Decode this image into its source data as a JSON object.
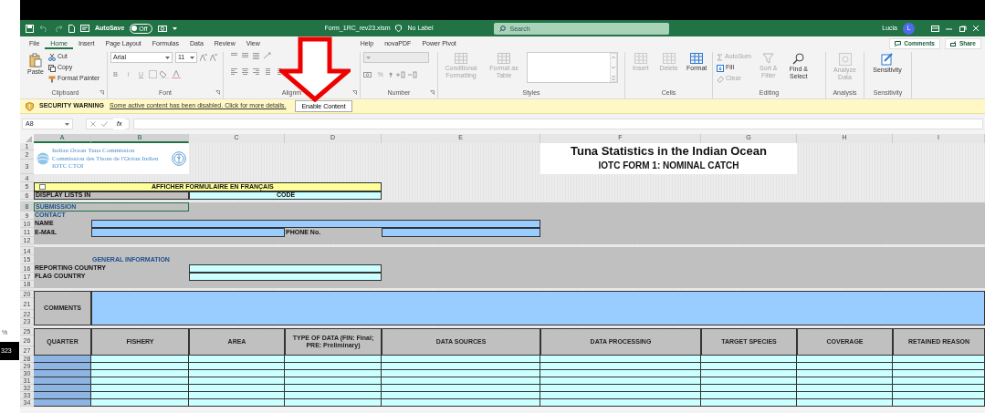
{
  "left_edge": {
    "zoom_fragment": "%",
    "page_fragment": "323"
  },
  "title_bar": {
    "autosave_label": "AutoSave",
    "autosave_toggle": {
      "label": "Off",
      "on": false
    },
    "filename": "Form_1RC_rev23.xlsm",
    "sensitivity_label": "No Label",
    "search": {
      "placeholder": "Search"
    },
    "user": "Lucia",
    "avatar": "L"
  },
  "ribbon_tabs": [
    {
      "label": "File",
      "selected": false
    },
    {
      "label": "Home",
      "selected": true
    },
    {
      "label": "Insert",
      "selected": false
    },
    {
      "label": "Page Layout",
      "selected": false
    },
    {
      "label": "Formulas",
      "selected": false
    },
    {
      "label": "Data",
      "selected": false
    },
    {
      "label": "Review",
      "selected": false
    },
    {
      "label": "View",
      "selected": false
    },
    {
      "label": "Help",
      "selected": false
    },
    {
      "label": "novaPDF",
      "selected": false
    },
    {
      "label": "Power Pivot",
      "selected": false
    }
  ],
  "ribbon_actions": [
    "Comments",
    "Share"
  ],
  "ribbon_groups": [
    {
      "label": "Clipboard",
      "kind": "clipboard",
      "items": [
        {
          "label": "Paste",
          "disabled": false
        },
        {
          "label": "Cut",
          "disabled": false
        },
        {
          "label": "Copy",
          "disabled": false
        },
        {
          "label": "Format Painter",
          "disabled": false
        }
      ]
    },
    {
      "label": "Font",
      "kind": "font",
      "font_name": "Arial",
      "font_size": "11",
      "items": [
        {
          "label": "B",
          "disabled": true
        },
        {
          "label": "I",
          "disabled": true
        },
        {
          "label": "U",
          "disabled": true
        }
      ]
    },
    {
      "label": "Alignm",
      "kind": "alignment"
    },
    {
      "label": "Number",
      "kind": "number",
      "items": [
        {
          "label": "%",
          "disabled": true
        }
      ]
    },
    {
      "label": "Styles",
      "kind": "styles",
      "items": [
        {
          "label": "Conditional Formatting",
          "disabled": true
        },
        {
          "label": "Format as Table",
          "disabled": true
        }
      ]
    },
    {
      "label": "Cells",
      "kind": "large",
      "items": [
        {
          "label": "Insert",
          "disabled": true
        },
        {
          "label": "Delete",
          "disabled": true
        },
        {
          "label": "Format",
          "disabled": false
        }
      ]
    },
    {
      "label": "Editing",
      "kind": "editing",
      "items": [
        {
          "label": "AutoSum",
          "disabled": true
        },
        {
          "label": "Fill",
          "disabled": false
        },
        {
          "label": "Clear",
          "disabled": true
        },
        {
          "label": "Sort & Filter",
          "disabled": true
        },
        {
          "label": "Find & Select",
          "disabled": false
        }
      ]
    },
    {
      "label": "Analysis",
      "kind": "large",
      "items": [
        {
          "label": "Analyze Data",
          "disabled": true
        }
      ]
    },
    {
      "label": "Sensitivity",
      "kind": "large",
      "items": [
        {
          "label": "Sensitivity",
          "disabled": false
        }
      ]
    }
  ],
  "security_bar": {
    "label": "SECURITY WARNING",
    "message": "Some active content has been disabled. Click for more details.",
    "button": "Enable Content"
  },
  "formula_bar": {
    "name_box": "A8",
    "function_symbol": "fx"
  },
  "sheet": {
    "columns": [
      {
        "label": "A",
        "selected": true
      },
      {
        "label": "B",
        "selected": true
      },
      {
        "label": "C",
        "selected": false
      },
      {
        "label": "D",
        "selected": false
      },
      {
        "label": "E",
        "selected": false
      },
      {
        "label": "F",
        "selected": false
      },
      {
        "label": "G",
        "selected": false
      },
      {
        "label": "H",
        "selected": false
      },
      {
        "label": "I",
        "selected": false
      }
    ],
    "rows": [
      {
        "label": "1",
        "selected": false
      },
      {
        "label": "2",
        "selected": false
      },
      {
        "label": "3",
        "selected": false
      },
      {
        "label": "4",
        "selected": false
      },
      {
        "label": "5",
        "selected": false
      },
      {
        "label": "6",
        "selected": false
      },
      {
        "selected": false
      },
      {
        "label": "8",
        "selected": true
      },
      {
        "label": "9",
        "selected": false
      },
      {
        "label": "10",
        "selected": false
      },
      {
        "label": "11",
        "selected": false
      },
      {
        "label": "12",
        "selected": false
      },
      {
        "selected": false
      },
      {
        "label": "14",
        "selected": false
      },
      {
        "label": "15",
        "selected": false
      },
      {
        "label": "16",
        "selected": false
      },
      {
        "label": "17",
        "selected": false
      },
      {
        "label": "18",
        "selected": false
      },
      {
        "selected": false
      },
      {
        "label": "20",
        "selected": false
      },
      {
        "label": "21",
        "selected": false
      },
      {
        "label": "22",
        "selected": false
      },
      {
        "label": "23",
        "selected": false
      },
      {
        "selected": false
      },
      {
        "label": "25",
        "selected": false
      },
      {
        "label": "26",
        "selected": false
      },
      {
        "label": "27",
        "selected": false
      },
      {
        "label": "28",
        "selected": false
      },
      {
        "label": "29",
        "selected": false
      },
      {
        "label": "30",
        "selected": false
      },
      {
        "label": "31",
        "selected": false
      },
      {
        "label": "32",
        "selected": false
      },
      {
        "label": "33",
        "selected": false
      },
      {
        "label": "34",
        "selected": false
      }
    ],
    "header_banner": {
      "org_name_en": "Indian Ocean Tuna Commission",
      "org_name_fr": "Commission des Thons de l'Océan Indien",
      "org_abbrev": "IOTC CTOI",
      "title": "Tuna Statistics in the Indian Ocean",
      "subtitle": "IOTC FORM 1: NOMINAL CATCH"
    },
    "language_toggle": {
      "label": "AFFICHER FORMULAIRE EN FRANÇAIS",
      "checked": false
    },
    "display_lists": {
      "label": "DISPLAY LISTS IN",
      "value": "CODE"
    },
    "submission_label": "SUBMISSION",
    "contact_heading": "CONTACT",
    "contact_fields": [
      {
        "label": "NAME"
      },
      {
        "label": "E-MAIL"
      },
      {
        "label": "PHONE No."
      }
    ],
    "general_heading": "GENERAL INFORMATION",
    "general_fields": [
      {
        "label": "REPORTING COUNTRY"
      },
      {
        "label": "FLAG COUNTRY"
      }
    ],
    "comments": {
      "label": "COMMENTS"
    },
    "catch_table": {
      "columns": [
        "QUARTER",
        "FISHERY",
        "AREA",
        "TYPE OF DATA (FIN: Final; PRE: Preliminary)",
        "DATA SOURCES",
        "DATA PROCESSING",
        "TARGET SPECIES",
        "COVERAGE",
        "RETAINED REASON"
      ]
    }
  }
}
